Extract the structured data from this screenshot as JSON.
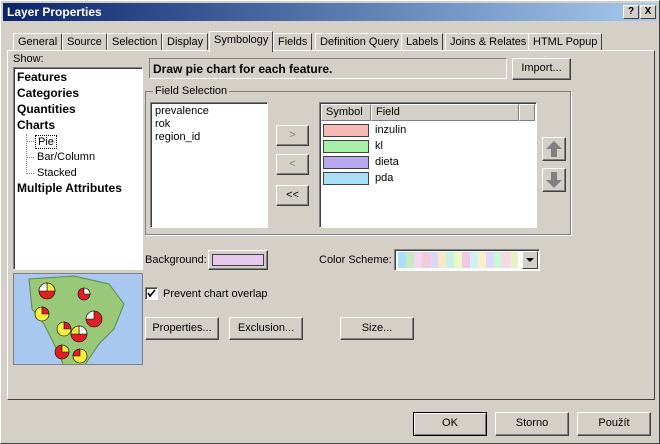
{
  "window": {
    "title": "Layer Properties",
    "help_label": "?",
    "close_label": "X"
  },
  "tabs": [
    {
      "label": "General"
    },
    {
      "label": "Source"
    },
    {
      "label": "Selection"
    },
    {
      "label": "Display"
    },
    {
      "label": "Symbology",
      "active": true
    },
    {
      "label": "Fields"
    },
    {
      "label": "Definition Query"
    },
    {
      "label": "Labels"
    },
    {
      "label": "Joins & Relates"
    },
    {
      "label": "HTML Popup"
    }
  ],
  "show": {
    "label": "Show:",
    "items": [
      {
        "label": "Features"
      },
      {
        "label": "Categories"
      },
      {
        "label": "Quantities"
      },
      {
        "label": "Charts"
      }
    ],
    "sub_items": [
      {
        "label": "Pie",
        "selected": true
      },
      {
        "label": "Bar/Column"
      },
      {
        "label": "Stacked"
      }
    ],
    "last_item": "Multiple Attributes"
  },
  "description": "Draw pie chart for each feature.",
  "import_label": "Import...",
  "field_selection": {
    "legend": "Field Selection",
    "available": [
      "prevalence",
      "rok",
      "region_id"
    ],
    "buttons": {
      "add": ">",
      "remove": "<",
      "remove_all": "<<"
    },
    "columns": {
      "symbol": "Symbol",
      "field": "Field"
    },
    "selected": [
      {
        "field": "inzulin",
        "color": "#f7b8b8"
      },
      {
        "field": "kl",
        "color": "#a8f0a8"
      },
      {
        "field": "dieta",
        "color": "#b8a8f0"
      },
      {
        "field": "pda",
        "color": "#a8e0f8"
      }
    ],
    "up_icon": "arrow-up-icon",
    "down_icon": "arrow-down-icon"
  },
  "background": {
    "label": "Background:",
    "color": "#e8c8f0"
  },
  "color_scheme": {
    "label": "Color Scheme:",
    "colors": [
      "#a8e0f8",
      "#c8e8c8",
      "#f0d8f0",
      "#f8c8d8",
      "#d8d8f8",
      "#f8e8c8",
      "#c8f0e8",
      "#e8f8c8",
      "#f0c8e0",
      "#d0f0f8",
      "#f8f0c8",
      "#e0d8f8",
      "#c8f8d8",
      "#f8d8e8",
      "#e8f0c8"
    ]
  },
  "prevent_overlap": {
    "label": "Prevent chart overlap",
    "checked": true
  },
  "action_buttons": {
    "properties": "Properties...",
    "exclusion": "Exclusion...",
    "size": "Size..."
  },
  "footer": {
    "ok": "OK",
    "cancel": "Storno",
    "apply": "Použít"
  }
}
